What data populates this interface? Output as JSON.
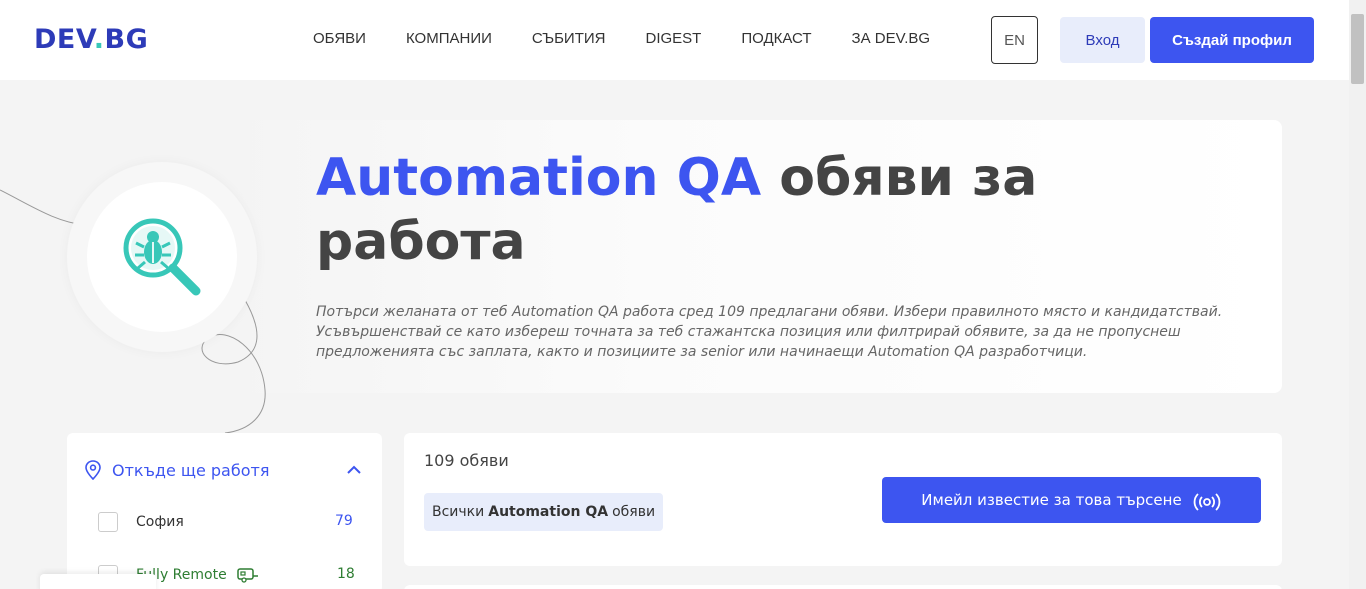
{
  "header": {
    "logo_text": "DEV",
    "logo_dot": ".",
    "logo_suffix": "BG",
    "nav": [
      "ОБЯВИ",
      "КОМПАНИИ",
      "СЪБИТИЯ",
      "DIGEST",
      "ПОДКАСТ",
      "ЗА DEV.BG"
    ],
    "lang": "EN",
    "login": "Вход",
    "signup": "Създай профил"
  },
  "hero": {
    "title_accent": "Automation QA",
    "title_rest": " обяви за работа",
    "description": "Потърси желаната от теб Automation QA работа сред 109 предлагани обяви. Избери правилното място и кандидатствай. Усъвършенствай се като избереш точната за теб стажантска позиция или филтрирай обявите, за да не пропуснеш предложенията със заплата, както и позициите за senior или начинаещи Automation QA разработчици.",
    "icon": "bug-search-icon"
  },
  "filter": {
    "title": "Откъде ще работя",
    "items": [
      {
        "label": "София",
        "count": "79",
        "count_color": "#3d55f0"
      },
      {
        "label": "Fully Remote",
        "count": "18",
        "count_color": "#2e7d32"
      }
    ]
  },
  "results": {
    "count_label": "109 обяви",
    "tag_prefix": "Всички",
    "tag_bold": "Automation QA",
    "tag_suffix": "обяви",
    "alert_button": "Имейл известие за това търсене"
  },
  "colors": {
    "accent": "#3d55f0",
    "logo": "#2d3bb8",
    "teal": "#38c7b8",
    "green": "#2e7d32"
  }
}
